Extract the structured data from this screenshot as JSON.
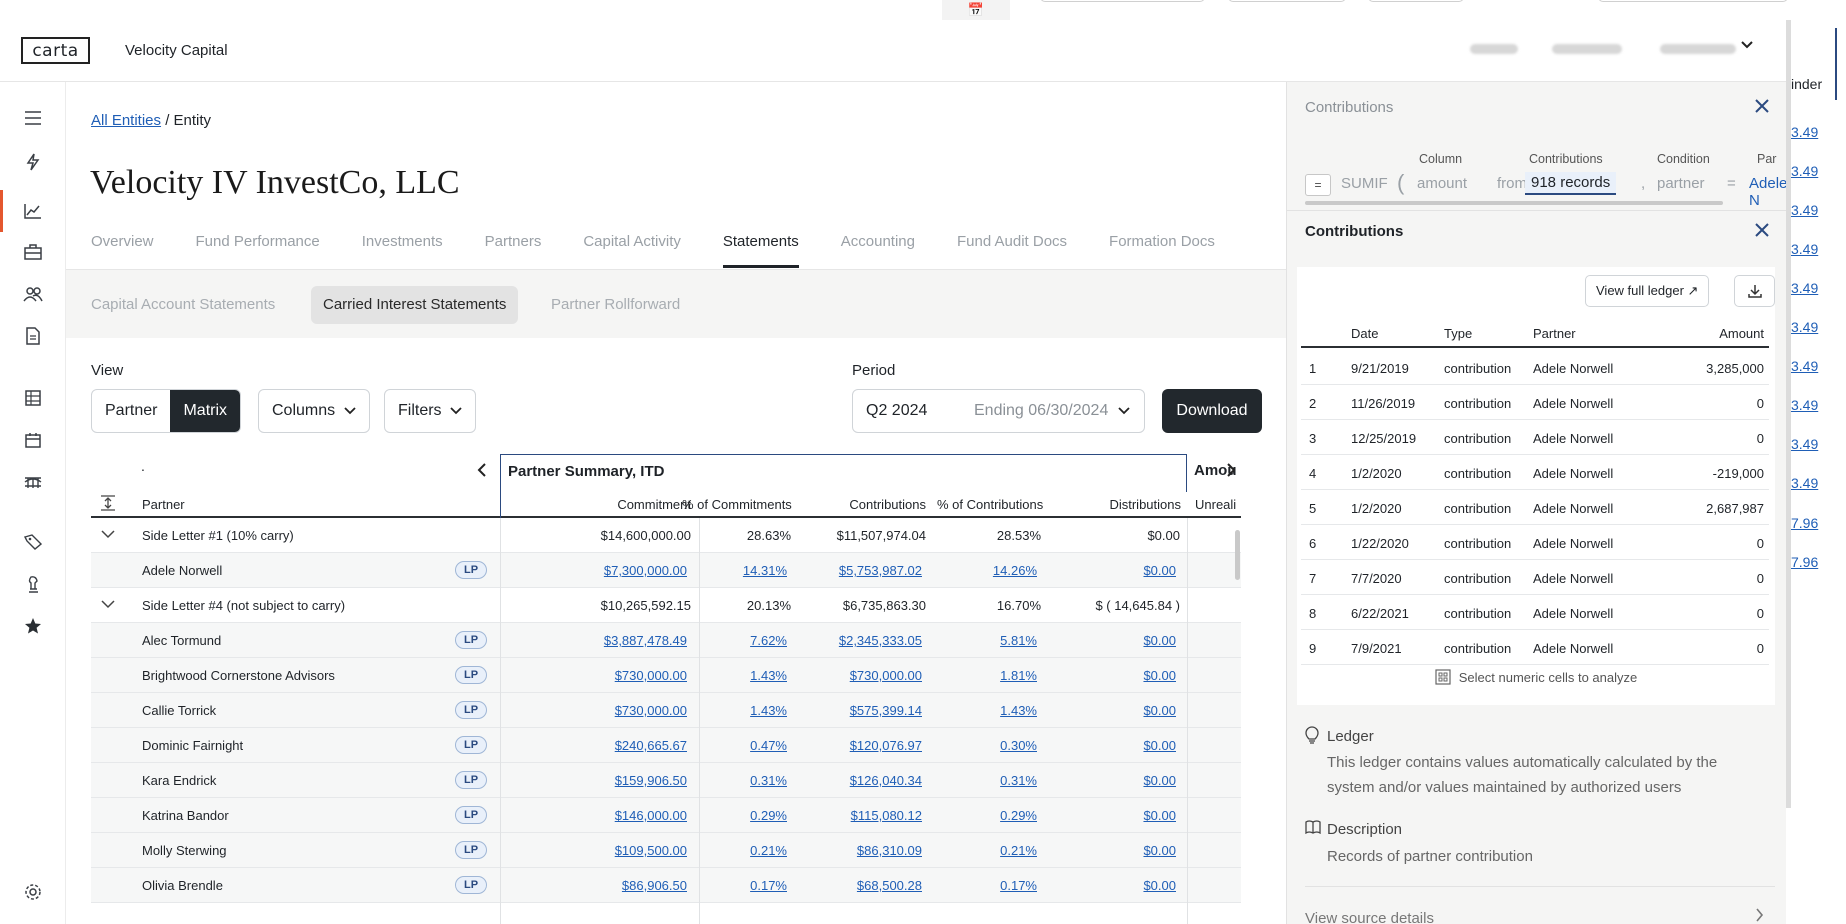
{
  "header": {
    "logo_text": "carta",
    "company": "Velocity Capital",
    "account_chevron": "chevron-down"
  },
  "sidebar": {
    "icons": [
      "menu-icon",
      "lightning-icon",
      "chart-icon",
      "briefcase-icon",
      "people-icon",
      "document-icon",
      "table-icon",
      "calendar-icon",
      "bridge-icon",
      "tag-icon",
      "chess-icon",
      "star-icon",
      "settings-icon"
    ]
  },
  "main": {
    "breadcrumb": {
      "link": "All Entities",
      "sep": " / ",
      "current": "Entity"
    },
    "title": "Velocity IV InvestCo, LLC",
    "tabs": [
      "Overview",
      "Fund Performance",
      "Investments",
      "Partners",
      "Capital Activity",
      "Statements",
      "Accounting",
      "Fund Audit Docs",
      "Formation Docs"
    ],
    "subtabs": [
      "Capital Account Statements",
      "Carried Interest Statements",
      "Partner Rollforward"
    ],
    "view_label": "View",
    "view_options": [
      "Partner",
      "Matrix"
    ],
    "columns_label": "Columns",
    "filters_label": "Filters",
    "period_label": "Period",
    "period_value": "Q2 2024",
    "period_ending": "Ending 06/30/2024",
    "download_label": "Download"
  },
  "table": {
    "dot": ".",
    "group_header": "Partner Summary, ITD",
    "group_header2": "Amou",
    "columns": [
      "Partner",
      "Commitment",
      "% of Commitments",
      "Contributions",
      "% of Contributions",
      "Distributions",
      "Unreali"
    ],
    "rows": [
      {
        "type": "group",
        "name": "Side Letter #1 (10% carry)",
        "commitment": "$14,600,000.00",
        "pct_commit": "28.63%",
        "contrib": "$11,507,974.04",
        "pct_contrib": "28.53%",
        "dist": "$0.00"
      },
      {
        "type": "child",
        "name": "Adele Norwell",
        "badge": "LP",
        "commitment": "$7,300,000.00",
        "pct_commit": "14.31%",
        "contrib": "$5,753,987.02",
        "pct_contrib": "14.26%",
        "dist": "$0.00"
      },
      {
        "type": "group",
        "name": "Side Letter #4 (not subject to carry)",
        "commitment": "$10,265,592.15",
        "pct_commit": "20.13%",
        "contrib": "$6,735,863.30",
        "pct_contrib": "16.70%",
        "dist": "$ ( 14,645.84 )"
      },
      {
        "type": "child",
        "name": "Alec Tormund",
        "badge": "LP",
        "commitment": "$3,887,478.49",
        "pct_commit": "7.62%",
        "contrib": "$2,345,333.05",
        "pct_contrib": "5.81%",
        "dist": "$0.00"
      },
      {
        "type": "child",
        "name": "Brightwood Cornerstone Advisors",
        "badge": "LP",
        "commitment": "$730,000.00",
        "pct_commit": "1.43%",
        "contrib": "$730,000.00",
        "pct_contrib": "1.81%",
        "dist": "$0.00"
      },
      {
        "type": "child",
        "name": "Callie Torrick",
        "badge": "LP",
        "commitment": "$730,000.00",
        "pct_commit": "1.43%",
        "contrib": "$575,399.14",
        "pct_contrib": "1.43%",
        "dist": "$0.00"
      },
      {
        "type": "child",
        "name": "Dominic Fairnight",
        "badge": "LP",
        "commitment": "$240,665.67",
        "pct_commit": "0.47%",
        "contrib": "$120,076.97",
        "pct_contrib": "0.30%",
        "dist": "$0.00"
      },
      {
        "type": "child",
        "name": "Kara Endrick",
        "badge": "LP",
        "commitment": "$159,906.50",
        "pct_commit": "0.31%",
        "contrib": "$126,040.34",
        "pct_contrib": "0.31%",
        "dist": "$0.00"
      },
      {
        "type": "child",
        "name": "Katrina Bandor",
        "badge": "LP",
        "commitment": "$146,000.00",
        "pct_commit": "0.29%",
        "contrib": "$115,080.12",
        "pct_contrib": "0.29%",
        "dist": "$0.00"
      },
      {
        "type": "child",
        "name": "Molly Sterwing",
        "badge": "LP",
        "commitment": "$109,500.00",
        "pct_commit": "0.21%",
        "contrib": "$86,310.09",
        "pct_contrib": "0.21%",
        "dist": "$0.00"
      },
      {
        "type": "child",
        "name": "Olivia Brendle",
        "badge": "LP",
        "commitment": "$86,906.50",
        "pct_commit": "0.17%",
        "contrib": "$68,500.28",
        "pct_contrib": "0.17%",
        "dist": "$0.00"
      }
    ]
  },
  "panel": {
    "formula_title": "Contributions",
    "formula": {
      "eq": "=",
      "fn": "SUMIF",
      "paren": "(",
      "col_label": "Column",
      "col_value": "amount",
      "from": "from",
      "src_label": "Contributions",
      "src_value": "918 records",
      "comma": ",",
      "cond_label": "Condition",
      "cond_value": "partner",
      "eq2": "=",
      "par_label": "Par",
      "par_value": "Adele N"
    },
    "ledger_title": "Contributions",
    "view_full_ledger": "View full ledger ↗",
    "ledger_columns": [
      "Date",
      "Type",
      "Partner",
      "Amount"
    ],
    "ledger_rows": [
      {
        "n": "1",
        "date": "9/21/2019",
        "type": "contribution",
        "partner": "Adele Norwell",
        "amount": "3,285,000"
      },
      {
        "n": "2",
        "date": "11/26/2019",
        "type": "contribution",
        "partner": "Adele Norwell",
        "amount": "0"
      },
      {
        "n": "3",
        "date": "12/25/2019",
        "type": "contribution",
        "partner": "Adele Norwell",
        "amount": "0"
      },
      {
        "n": "4",
        "date": "1/2/2020",
        "type": "contribution",
        "partner": "Adele Norwell",
        "amount": "-219,000"
      },
      {
        "n": "5",
        "date": "1/2/2020",
        "type": "contribution",
        "partner": "Adele Norwell",
        "amount": "2,687,987"
      },
      {
        "n": "6",
        "date": "1/22/2020",
        "type": "contribution",
        "partner": "Adele Norwell",
        "amount": "0"
      },
      {
        "n": "7",
        "date": "7/7/2020",
        "type": "contribution",
        "partner": "Adele Norwell",
        "amount": "0"
      },
      {
        "n": "8",
        "date": "6/22/2021",
        "type": "contribution",
        "partner": "Adele Norwell",
        "amount": "0"
      },
      {
        "n": "9",
        "date": "7/9/2021",
        "type": "contribution",
        "partner": "Adele Norwell",
        "amount": "0"
      }
    ],
    "analyze_hint": "Select numeric cells to analyze",
    "ledger_info_title": "Ledger",
    "ledger_info_text": "This ledger contains values automatically calculated by the system and/or values maintained by authorized users",
    "description_title": "Description",
    "description_text": "Records of partner contribution",
    "view_source": "View source details"
  },
  "sliver": {
    "header": "inder",
    "values": [
      "3.49",
      "3.49",
      "3.49",
      "3.49",
      "3.49",
      "3.49",
      "3.49",
      "3.49",
      "3.49",
      "3.49",
      "7.96",
      "7.96"
    ]
  }
}
